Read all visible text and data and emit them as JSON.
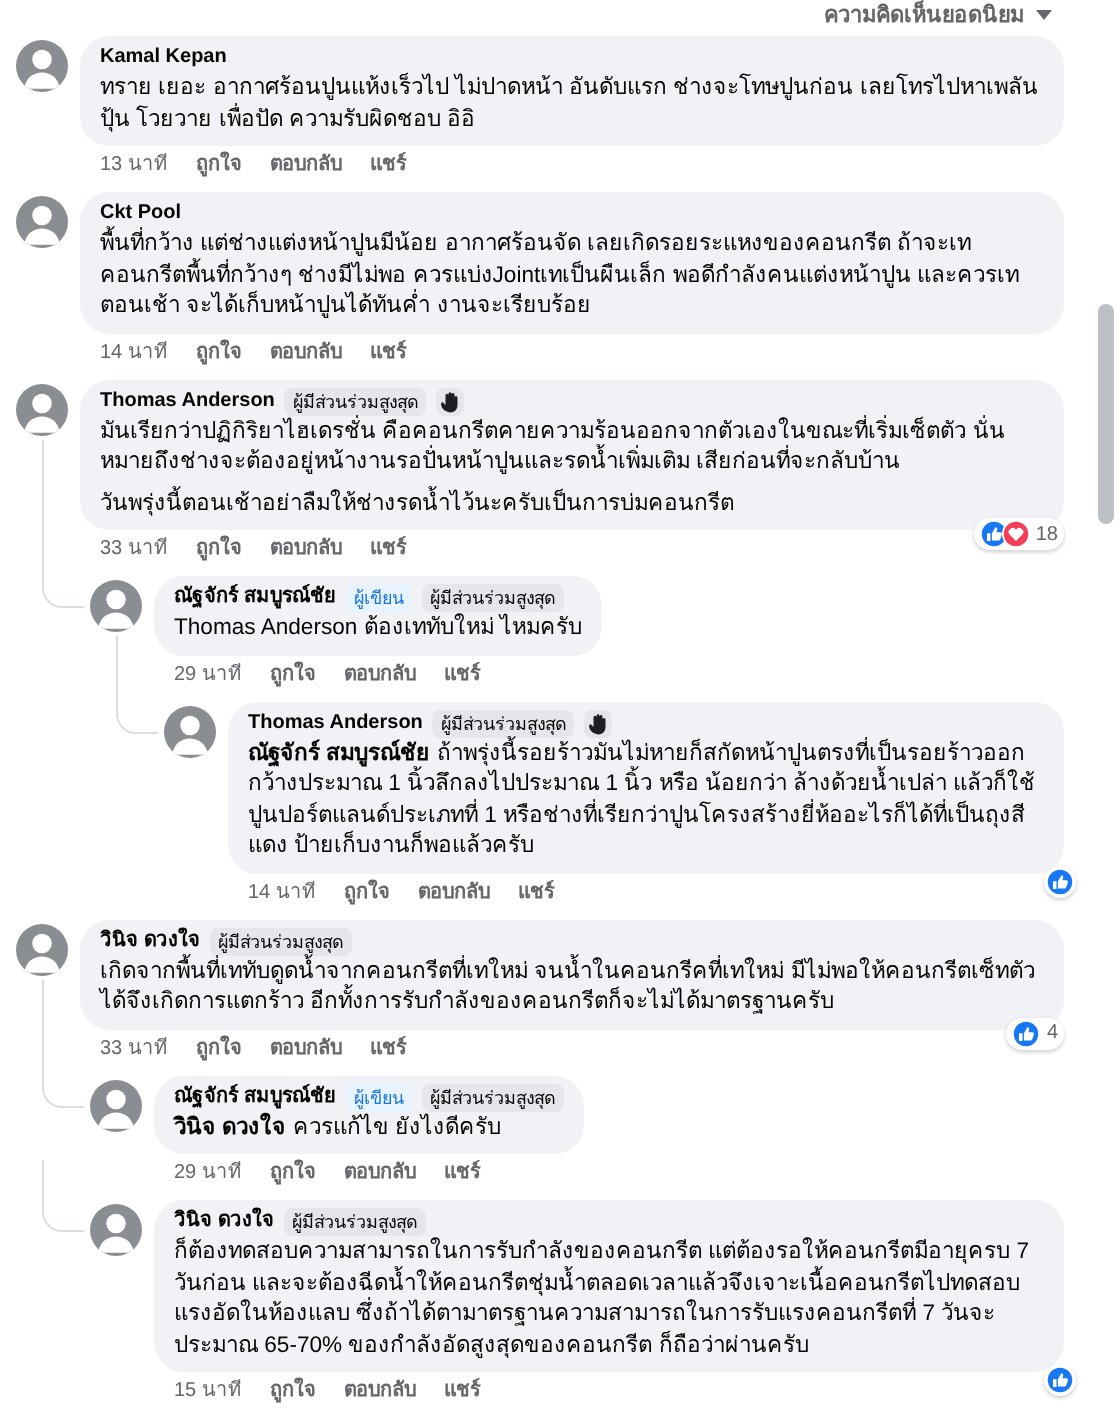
{
  "sort_label": "ความคิดเห็นยอดนิยม",
  "comments": [
    {
      "author": "Kamal Kepan",
      "text": "ทราย เยอะ อากาศร้อนปูนแห้งเร็วไป ไม่ปาดหน้า อันดับแรก ช่างจะโทษปูนก่อน เลยโทรไปหาเพลันปุ้น โวยวาย เพื่อปัด ความรับผิดชอบ อิอิ",
      "time": "13 นาที",
      "actions": [
        "ถูกใจ",
        "ตอบกลับ",
        "แชร์"
      ]
    },
    {
      "author": "Ckt Pool",
      "text": "พื้นที่กว้าง แต่ช่างแต่งหน้าปูนมีน้อย อากาศร้อนจัด เลยเกิดรอยระแหงของคอนกรีต ถ้าจะเทคอนกรีตพื้นที่กว้างๆ ช่างมีไม่พอ ควรแบ่งJointเทเป็นผืนเล็ก พอดีกำลังคนแต่งหน้าปูน และควรเทตอนเช้า จะได้เก็บหน้าปูนได้ทันค่ำ งานจะเรียบร้อย",
      "time": "14 นาที",
      "actions": [
        "ถูกใจ",
        "ตอบกลับ",
        "แชร์"
      ]
    },
    {
      "author": "Thomas Anderson",
      "badges": [
        {
          "kind": "top",
          "label": "ผู้มีส่วนร่วมสูงสุด"
        }
      ],
      "wave": true,
      "text": "มันเรียกว่าปฏิกิริยาไฮเดรชั่น คือคอนกรีตคายความร้อนออกจากตัวเองในขณะที่เริ่มเซ็ตตัว นั่นหมายถึงช่างจะต้องอยู่หน้างานรอปั่นหน้าปูนและรดน้ำเพิ่มเติม เสียก่อนที่จะกลับบ้าน\n\nวันพรุ่งนี้ตอนเช้าอย่าลืมให้ช่างรดน้ำไว้นะครับเป็นการบ่มคอนกรีต",
      "time": "33 นาที",
      "actions": [
        "ถูกใจ",
        "ตอบกลับ",
        "แชร์"
      ],
      "reactions": [
        {
          "kind": "like"
        },
        {
          "kind": "love"
        }
      ],
      "reaction_count": "18",
      "children": [
        {
          "author": "ณัฐจักร์ สมบูรณ์ชัย",
          "badges": [
            {
              "kind": "author",
              "label": "ผู้เขียน"
            },
            {
              "kind": "top",
              "label": "ผู้มีส่วนร่วมสูงสุด"
            }
          ],
          "text": "Thomas Anderson ต้องเททับใหม่ ไหมครับ",
          "time": "29 นาที",
          "actions": [
            "ถูกใจ",
            "ตอบกลับ",
            "แชร์"
          ],
          "children": [
            {
              "author": "Thomas Anderson",
              "badges": [
                {
                  "kind": "top",
                  "label": "ผู้มีส่วนร่วมสูงสุด"
                }
              ],
              "wave": true,
              "text": "**ณัฐจักร์ สมบูรณ์ชัย** ถ้าพรุ่งนี้รอยร้าวมันไม่หายก็สกัดหน้าปูนตรงที่เป็นรอยร้าวออกกว้างประมาณ 1 นิ้วลึกลงไปประมาณ 1 นิ้ว หรือ น้อยกว่า ล้างด้วยน้ำเปล่า แล้วก็ใช้ปูนปอร์ตแลนด์ประเภทที่ 1 หรือช่างที่เรียกว่าปูนโครงสร้างยี่ห้ออะไรก็ได้ที่เป็นถุงสีแดง ป้ายเก็บงานก็พอแล้วครับ",
              "time": "14 นาที",
              "actions": [
                "ถูกใจ",
                "ตอบกลับ",
                "แชร์"
              ],
              "reactions": [
                {
                  "kind": "like"
                }
              ]
            }
          ]
        }
      ]
    },
    {
      "author": "วินิจ ดวงใจ",
      "badges": [
        {
          "kind": "top",
          "label": "ผู้มีส่วนร่วมสูงสุด"
        }
      ],
      "text": "เกิดจากพื้นที่เททับดูดน้ำจากคอนกรีตที่เทใหม่ จนน้ำในคอนกรีคที่เทใหม่ มีไม่พอให้คอนกรีตเซ็ทตัวได้จึงเกิดการแตกร้าว อีกทั้งการรับกำลังของคอนกรีตก็จะไม่ได้มาตรฐานครับ",
      "time": "33 นาที",
      "actions": [
        "ถูกใจ",
        "ตอบกลับ",
        "แชร์"
      ],
      "reactions": [
        {
          "kind": "like"
        }
      ],
      "reaction_count": "4",
      "children": [
        {
          "author": "ณัฐจักร์ สมบูรณ์ชัย",
          "badges": [
            {
              "kind": "author",
              "label": "ผู้เขียน"
            },
            {
              "kind": "top",
              "label": "ผู้มีส่วนร่วมสูงสุด"
            }
          ],
          "text": "**วินิจ ดวงใจ** ควรแก้ไข ยังไงดีครับ",
          "time": "29 นาที",
          "actions": [
            "ถูกใจ",
            "ตอบกลับ",
            "แชร์"
          ]
        },
        {
          "author": "วินิจ ดวงใจ",
          "badges": [
            {
              "kind": "top",
              "label": "ผู้มีส่วนร่วมสูงสุด"
            }
          ],
          "text": "ก็ต้องทดสอบความสามารถในการรับกำลังของคอนกรีต แต่ต้องรอให้คอนกรีตมีอายุครบ 7 วันก่อน และจะต้องฉีดน้ำให้คอนกรีตชุ่มน้ำตลอดเวลาแล้วจึงเจาะเนื้อคอนกรีตไปทดสอบแรงอัดในห้องแลบ ซึ่งถ้าได้ตามาตรฐานความสามารถในการรับแรงคอนกรีตที่ 7 วันจะประมาณ 65-70% ของกำลังอัดสูงสุดของคอนกรีต ก็ถือว่าผ่านครับ",
          "time": "15 นาที",
          "actions": [
            "ถูกใจ",
            "ตอบกลับ",
            "แชร์"
          ],
          "reactions": [
            {
              "kind": "like"
            }
          ]
        }
      ]
    }
  ]
}
